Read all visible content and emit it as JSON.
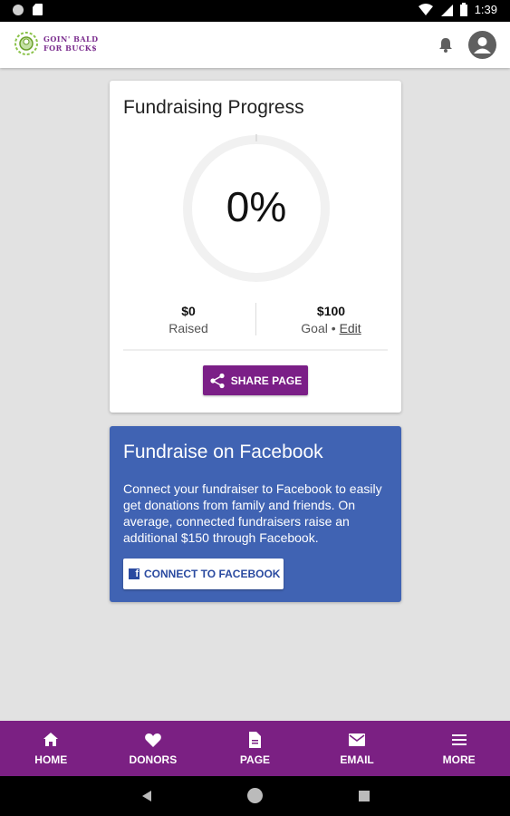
{
  "status_bar": {
    "time": "1:39",
    "icons": [
      "notification-dot-icon",
      "sd-card-icon",
      "wifi-icon",
      "signal-icon",
      "battery-icon"
    ]
  },
  "app_bar": {
    "logo_text_line1": "GOIN' BALD",
    "logo_text_line2": "FOR BUCK$",
    "icons": [
      "logo-mark",
      "bell-icon",
      "account-icon"
    ]
  },
  "progress_card": {
    "title": "Fundraising Progress",
    "percent_text": "0%",
    "progress_fraction": 0,
    "raised_amount": "$0",
    "raised_label": "Raised",
    "goal_amount": "$100",
    "goal_label": "Goal •",
    "edit_label": "Edit",
    "share_label": "SHARE PAGE"
  },
  "facebook_card": {
    "title": "Fundraise on Facebook",
    "body": "Connect your fundraiser to Facebook to easily get donations from family and friends. On average, connected fundraisers raise an additional $150 through Facebook.",
    "button_label": "CONNECT TO FACEBOOK",
    "button_icon_glyph": "f"
  },
  "bottom_nav": {
    "items": [
      {
        "label": "HOME",
        "icon": "home-icon"
      },
      {
        "label": "DONORS",
        "icon": "heart-icon"
      },
      {
        "label": "PAGE",
        "icon": "page-icon"
      },
      {
        "label": "EMAIL",
        "icon": "email-icon"
      },
      {
        "label": "MORE",
        "icon": "menu-icon"
      }
    ]
  },
  "colors": {
    "brand_purple": "#7b2083",
    "facebook_blue": "#4063b3",
    "background": "#e2e2e2"
  }
}
